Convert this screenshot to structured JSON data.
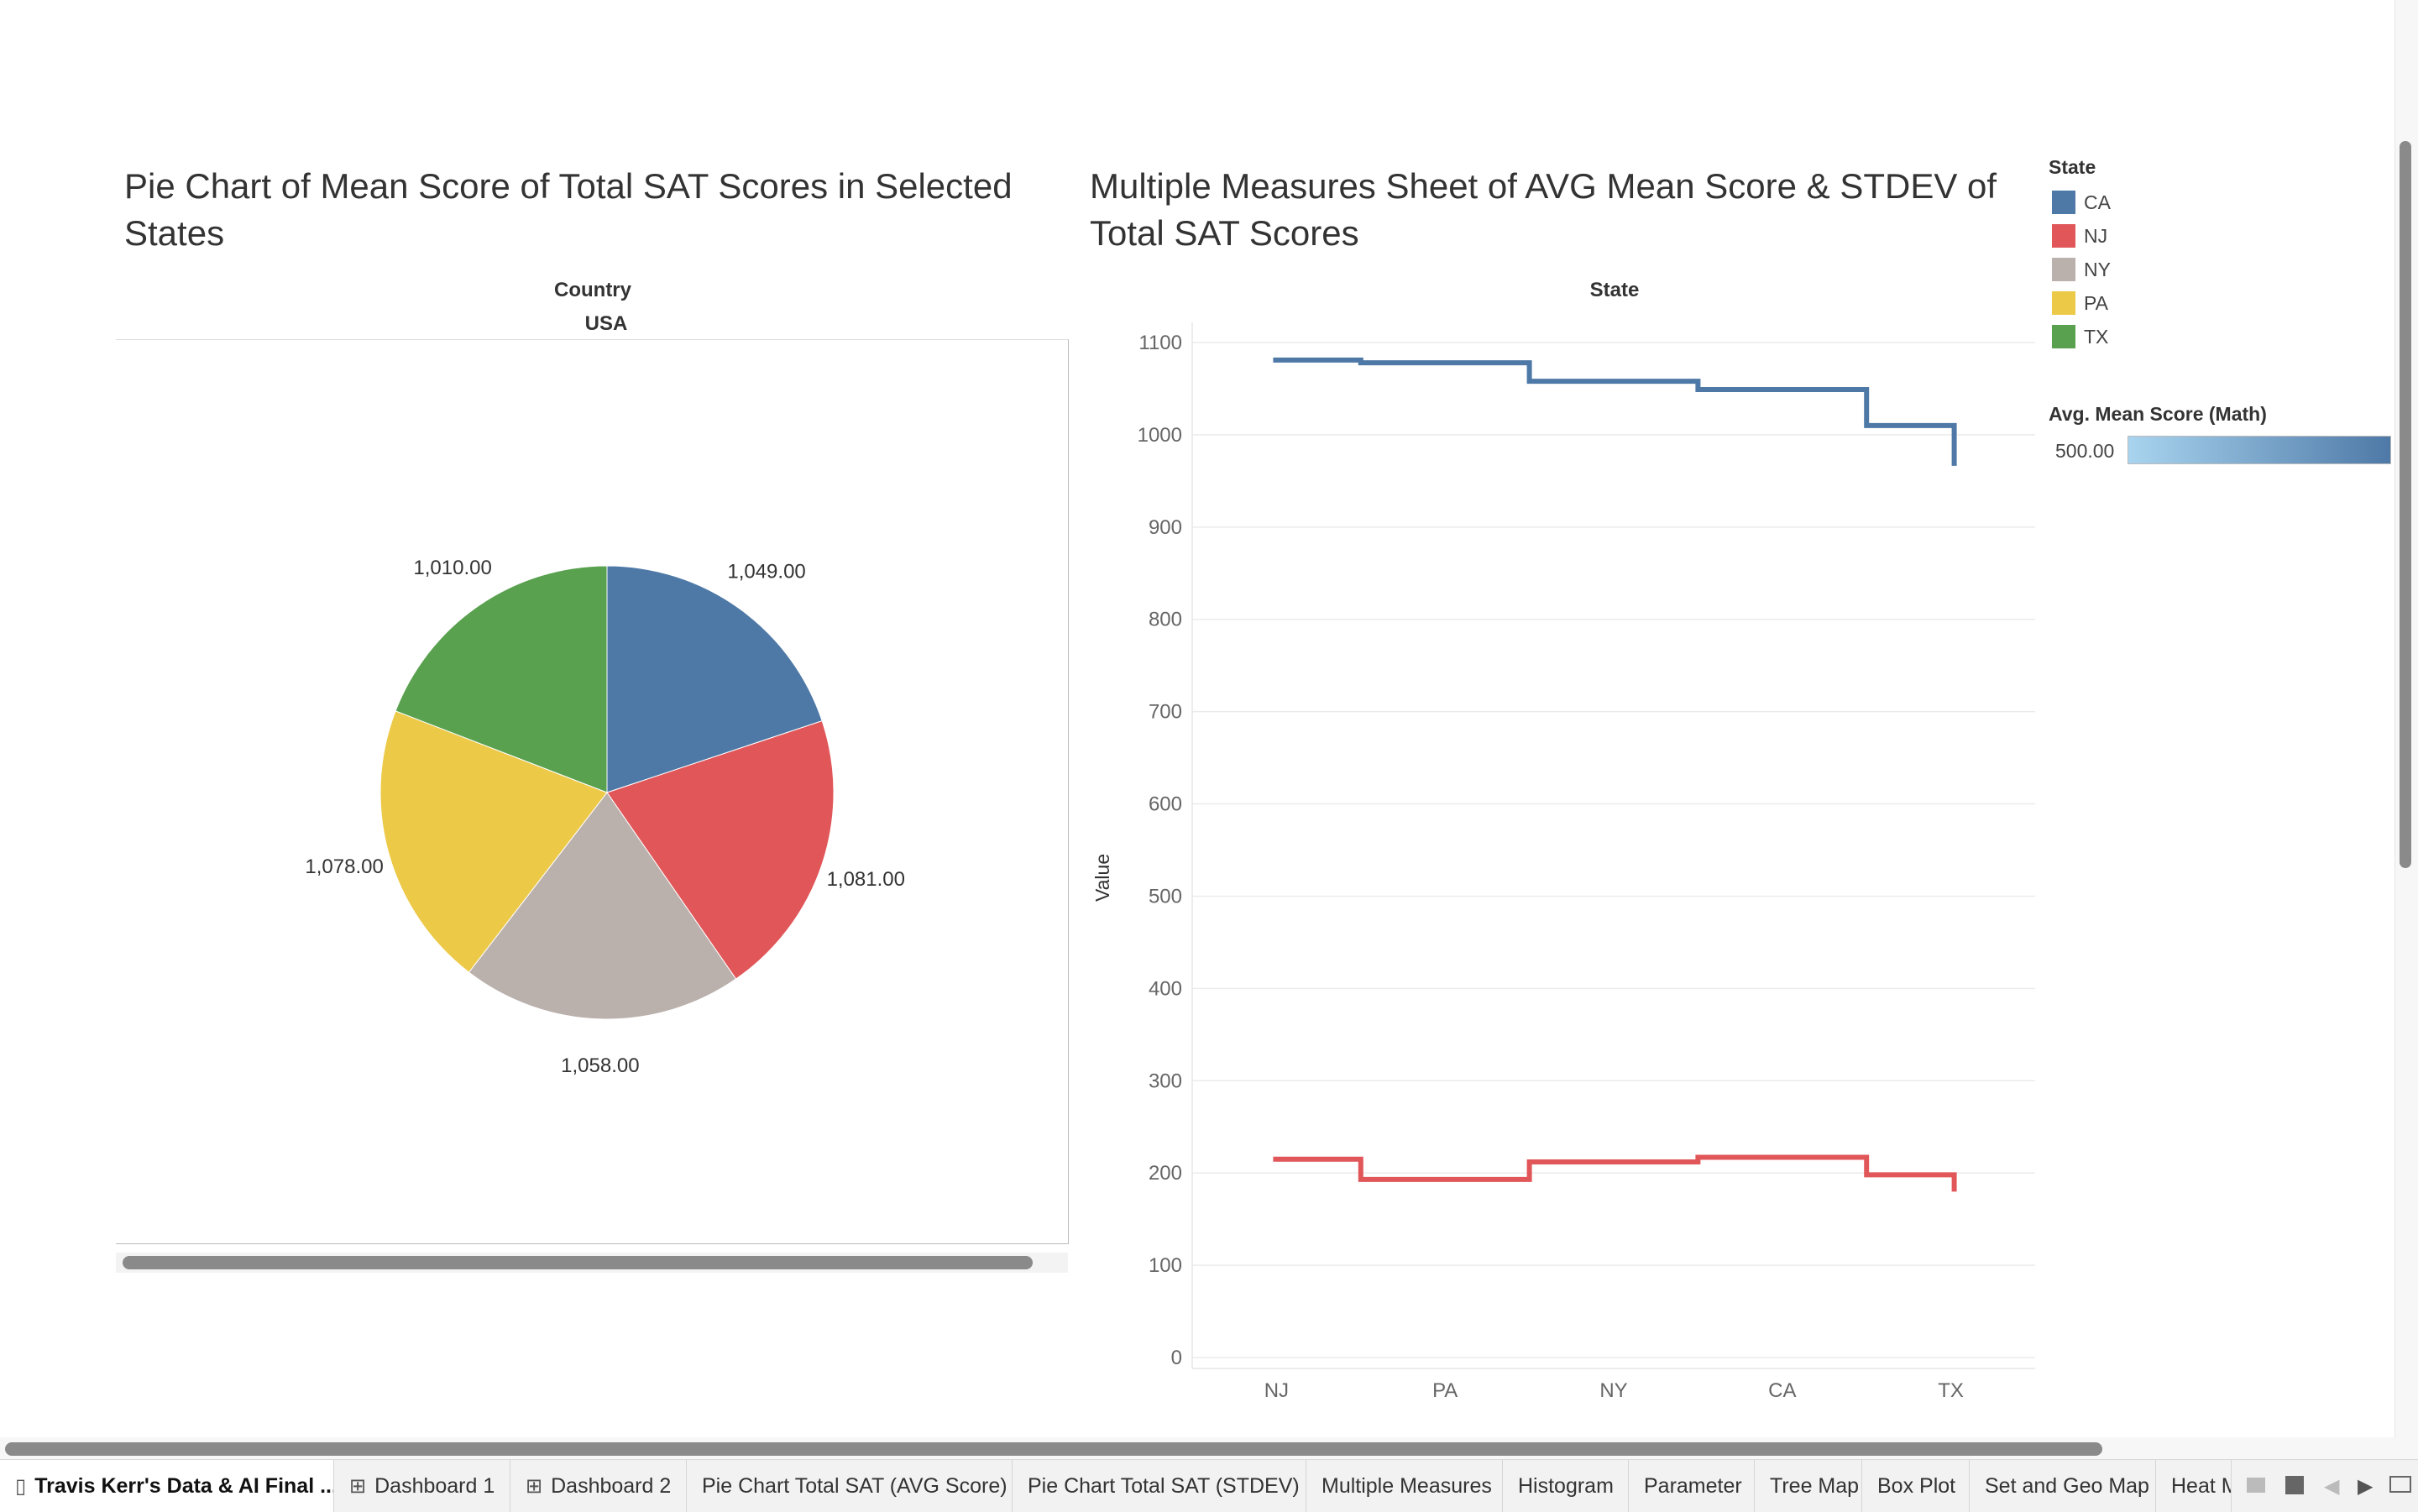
{
  "pie_sheet": {
    "title_line1": "Pie Chart of Mean Score of Total SAT Scores in Selected",
    "title_line2": "States",
    "column_header": "Country",
    "column_value": "USA"
  },
  "line_sheet": {
    "title_line1": "Multiple Measures Sheet of AVG Mean Score & STDEV of",
    "title_line2": "Total SAT Scores",
    "column_header": "State",
    "y_axis_label": "Value"
  },
  "legend": {
    "title": "State",
    "items": [
      {
        "label": "CA",
        "color": "#4e79a7"
      },
      {
        "label": "NJ",
        "color": "#e15759"
      },
      {
        "label": "NY",
        "color": "#bab0ac"
      },
      {
        "label": "PA",
        "color": "#edc948"
      },
      {
        "label": "TX",
        "color": "#59a14f"
      }
    ],
    "color_title": "Avg. Mean Score (Math)",
    "color_min_label": "500.00",
    "color_range": [
      "#a9d4ef",
      "#4e79a7"
    ]
  },
  "tabs": [
    {
      "label": "Travis Kerr's Data & AI Final ...",
      "icon": "book-icon",
      "active": true
    },
    {
      "label": "Dashboard 1",
      "icon": "grid-icon",
      "active": false
    },
    {
      "label": "Dashboard 2",
      "icon": "grid-icon",
      "active": false
    },
    {
      "label": "Pie Chart Total SAT (AVG Score)",
      "icon": "",
      "active": false
    },
    {
      "label": "Pie Chart Total SAT (STDEV)",
      "icon": "",
      "active": false
    },
    {
      "label": "Multiple Measures",
      "icon": "",
      "active": false
    },
    {
      "label": "Histogram",
      "icon": "",
      "active": false
    },
    {
      "label": "Parameter",
      "icon": "",
      "active": false
    },
    {
      "label": "Tree Map",
      "icon": "",
      "active": false
    },
    {
      "label": "Box Plot",
      "icon": "",
      "active": false
    },
    {
      "label": "Set and Geo Map",
      "icon": "",
      "active": false
    },
    {
      "label": "Heat M",
      "icon": "",
      "active": false
    }
  ],
  "chart_data": [
    {
      "type": "pie",
      "title": "Pie Chart of Mean Score of Total SAT Scores in Selected States",
      "slices": [
        {
          "label": "CA",
          "value": 1049,
          "value_label": "1,049.00",
          "color": "#4e79a7"
        },
        {
          "label": "NJ",
          "value": 1081,
          "value_label": "1,081.00",
          "color": "#e15759"
        },
        {
          "label": "NY",
          "value": 1058,
          "value_label": "1,058.00",
          "color": "#bab0ac"
        },
        {
          "label": "PA",
          "value": 1078,
          "value_label": "1,078.00",
          "color": "#edc948"
        },
        {
          "label": "TX",
          "value": 1010,
          "value_label": "1,010.00",
          "color": "#59a14f"
        }
      ]
    },
    {
      "type": "line",
      "title": "Multiple Measures Sheet of AVG Mean Score & STDEV of Total SAT Scores",
      "xlabel": "State",
      "ylabel": "Value",
      "categories": [
        "NJ",
        "PA",
        "NY",
        "CA",
        "TX"
      ],
      "ylim": [
        0,
        1100
      ],
      "yticks": [
        0,
        100,
        200,
        300,
        400,
        500,
        600,
        700,
        800,
        900,
        1000,
        1100
      ],
      "grid": true,
      "step": true,
      "series": [
        {
          "values": [
            1081,
            1078,
            1058,
            1049,
            1010
          ],
          "color": "#4e79a7"
        },
        {
          "values": [
            215,
            193,
            212,
            217,
            198
          ],
          "color": "#e15759"
        }
      ]
    }
  ]
}
